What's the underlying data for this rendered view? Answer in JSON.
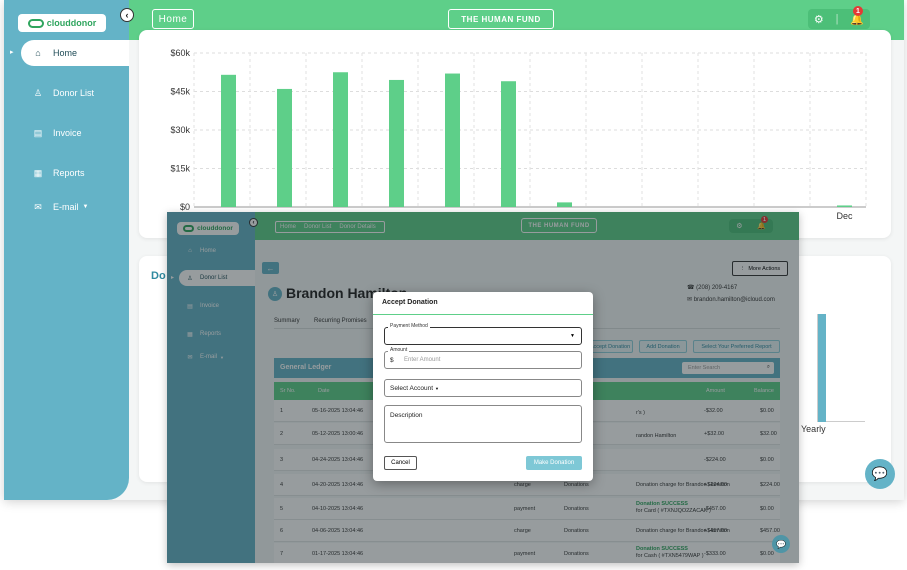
{
  "main": {
    "logo_text": "clouddonor",
    "collapse_icon": "chevron-left",
    "header": {
      "breadcrumb_home": "Home",
      "org_button": "THE HUMAN FUND",
      "notification_count": "1"
    },
    "sidebar": [
      {
        "label": "Home",
        "icon": "home-icon"
      },
      {
        "label": "Donor List",
        "icon": "user-icon"
      },
      {
        "label": "Invoice",
        "icon": "invoice-icon"
      },
      {
        "label": "Reports",
        "icon": "reports-icon"
      },
      {
        "label": "E-mail",
        "icon": "mail-icon"
      }
    ],
    "second_card_title_fragment": "Do",
    "second_card_axis_fragment": "Yearly"
  },
  "chart_data": {
    "type": "bar",
    "categories": [
      "",
      "",
      "",
      "",
      "",
      "",
      "",
      "",
      "",
      "",
      "",
      "Dec"
    ],
    "values": [
      51500,
      46000,
      52500,
      49500,
      52000,
      49000,
      1800,
      0,
      0,
      0,
      0,
      600
    ],
    "yticks": [
      "$60k",
      "$45k",
      "$30k",
      "$15k",
      "$0"
    ],
    "ylim": [
      0,
      60000
    ],
    "color": "#5ecf89",
    "grid": true
  },
  "front": {
    "logo_text": "clouddonor",
    "breadcrumb": [
      "Home",
      "Donor List",
      "Donor Details"
    ],
    "org_button": "THE HUMAN FUND",
    "notification_count": "1",
    "sidebar": [
      {
        "label": "Home"
      },
      {
        "label": "Donor List"
      },
      {
        "label": "Invoice"
      },
      {
        "label": "Reports"
      },
      {
        "label": "E-mail"
      }
    ],
    "donor_name": "Brandon Hamilton",
    "phone": "(208) 209-4167",
    "email": "brandon.hamilton@icloud.com",
    "more_actions": "More Actions",
    "tabs": [
      "Summary",
      "Recurring Promises"
    ],
    "action_buttons": [
      "Accept Donation",
      "Add Donation",
      "Select Your Preferred Report"
    ],
    "ledger_title": "General Ledger",
    "search_placeholder": "Enter Search",
    "columns": [
      "Sr No.",
      "Date",
      "Amount",
      "Balance"
    ],
    "rows": [
      {
        "no": "1",
        "date": "05-16-2025 13:04:46",
        "type": "",
        "category": "",
        "desc": "",
        "desc2": "r's )",
        "amount": "-$32.00",
        "balance": "$0.00"
      },
      {
        "no": "2",
        "date": "05-12-2025 13:00:46",
        "type": "",
        "category": "",
        "desc": "",
        "desc2": "randon Hamilton",
        "amount": "+$32.00",
        "balance": "$32.00"
      },
      {
        "no": "3",
        "date": "04-24-2025 13:04:46",
        "type": "",
        "category": "",
        "desc": "",
        "desc2": "",
        "amount": "-$224.00",
        "balance": "$0.00"
      },
      {
        "no": "4",
        "date": "04-20-2025 13:04:46",
        "type": "charge",
        "category": "Donations",
        "desc": "Donation charge for Brandon Hamilton",
        "desc2": "",
        "amount": "+$224.00",
        "balance": "$224.00"
      },
      {
        "no": "5",
        "date": "04-10-2025 13:04:46",
        "type": "payment",
        "category": "Donations",
        "desc": "Donation SUCCESS",
        "desc2": "for Card ( #TXNJQO2ZACAK )",
        "amount": "-$457.00",
        "balance": "$0.00"
      },
      {
        "no": "6",
        "date": "04-06-2025 13:04:46",
        "type": "charge",
        "category": "Donations",
        "desc": "Donation charge for Brandon Hamilton",
        "desc2": "",
        "amount": "+$457.00",
        "balance": "$457.00"
      },
      {
        "no": "7",
        "date": "01-17-2025 13:04:46",
        "type": "payment",
        "category": "Donations",
        "desc": "Donation SUCCESS",
        "desc2": "for Cash ( #TXN5479WAP )",
        "amount": "-$333.00",
        "balance": "$0.00"
      }
    ]
  },
  "modal": {
    "title": "Accept Donation",
    "payment_method_label": "Payment Method",
    "amount_label": "Amount",
    "currency": "$",
    "amount_placeholder": "Enter Amount",
    "account_select": "Select Account",
    "description_label": "Description",
    "cancel": "Cancel",
    "submit": "Make Donation"
  }
}
